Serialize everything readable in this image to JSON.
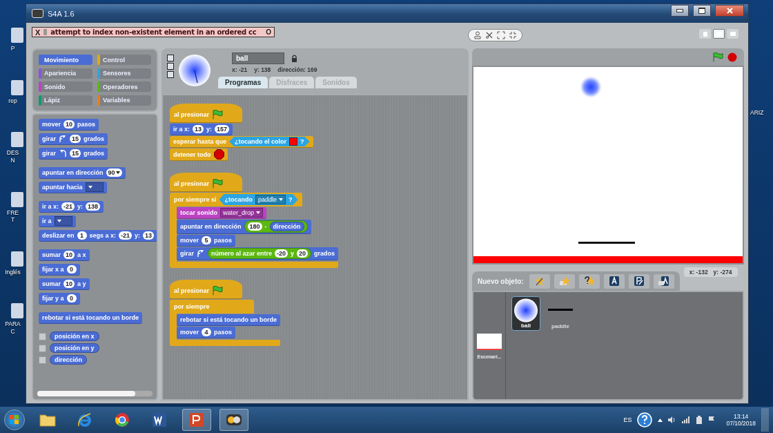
{
  "desktop": {
    "left_labels": [
      {
        "lines": [
          "P"
        ]
      },
      {
        "lines": [
          "rep"
        ]
      },
      {
        "lines": [
          "DES",
          "N"
        ]
      },
      {
        "lines": [
          "FRE",
          "T"
        ]
      },
      {
        "lines": [
          "Inglés"
        ]
      },
      {
        "lines": [
          "PARA",
          "C"
        ]
      }
    ],
    "right_labels": [
      "ARIZ"
    ]
  },
  "window": {
    "title": "S4A 1.6"
  },
  "error_bar": {
    "close": "X",
    "message": "attempt to index non-existent element in an ordered cc",
    "open": "O"
  },
  "view_modes": [
    {
      "selected": false
    },
    {
      "selected": true
    },
    {
      "selected": false
    }
  ],
  "categories": [
    {
      "label": "Movimiento",
      "color": "#4a6cd4",
      "selected": true
    },
    {
      "label": "Control",
      "color": "#e1a91a",
      "selected": false
    },
    {
      "label": "Apariencia",
      "color": "#8a55d7",
      "selected": false
    },
    {
      "label": "Sensores",
      "color": "#2ca5e2",
      "selected": false
    },
    {
      "label": "Sonido",
      "color": "#bb42c3",
      "selected": false
    },
    {
      "label": "Operadores",
      "color": "#5cb712",
      "selected": false
    },
    {
      "label": "Lápiz",
      "color": "#0e9a6c",
      "selected": false
    },
    {
      "label": "Variables",
      "color": "#ee7d16",
      "selected": false
    }
  ],
  "palette": {
    "groups": [
      [
        {
          "kind": "stack",
          "color": "#4a6cd4",
          "parts": [
            {
              "kind": "text",
              "text": "mover"
            },
            {
              "kind": "number",
              "text": "10"
            },
            {
              "kind": "text",
              "text": "pasos"
            }
          ]
        },
        {
          "kind": "stack",
          "color": "#4a6cd4",
          "parts": [
            {
              "kind": "text",
              "text": "girar"
            },
            {
              "kind": "turn_cw"
            },
            {
              "kind": "number",
              "text": "15"
            },
            {
              "kind": "text",
              "text": "grados"
            }
          ]
        },
        {
          "kind": "stack",
          "color": "#4a6cd4",
          "parts": [
            {
              "kind": "text",
              "text": "girar"
            },
            {
              "kind": "turn_ccw"
            },
            {
              "kind": "number",
              "text": "15"
            },
            {
              "kind": "text",
              "text": "grados"
            }
          ]
        }
      ],
      [
        {
          "kind": "stack",
          "color": "#4a6cd4",
          "parts": [
            {
              "kind": "text",
              "text": "apuntar en dirección"
            },
            {
              "kind": "number_dropdown",
              "text": "90"
            }
          ]
        },
        {
          "kind": "stack",
          "color": "#4a6cd4",
          "parts": [
            {
              "kind": "text",
              "text": "apuntar hacia"
            },
            {
              "kind": "dropdown"
            }
          ]
        }
      ],
      [
        {
          "kind": "stack",
          "color": "#4a6cd4",
          "parts": [
            {
              "kind": "text",
              "text": "ir a x:"
            },
            {
              "kind": "number",
              "text": "-21"
            },
            {
              "kind": "text",
              "text": "y:"
            },
            {
              "kind": "number",
              "text": "138"
            }
          ]
        },
        {
          "kind": "stack",
          "color": "#4a6cd4",
          "parts": [
            {
              "kind": "text",
              "text": "ir a"
            },
            {
              "kind": "dropdown"
            }
          ]
        },
        {
          "kind": "stack",
          "color": "#4a6cd4",
          "parts": [
            {
              "kind": "text",
              "text": "deslizar en"
            },
            {
              "kind": "number",
              "text": "1"
            },
            {
              "kind": "text",
              "text": "segs a x:"
            },
            {
              "kind": "number",
              "text": "-21"
            },
            {
              "kind": "text",
              "text": "y:"
            },
            {
              "kind": "number",
              "text": "13"
            }
          ]
        }
      ],
      [
        {
          "kind": "stack",
          "color": "#4a6cd4",
          "parts": [
            {
              "kind": "text",
              "text": "sumar"
            },
            {
              "kind": "number",
              "text": "10"
            },
            {
              "kind": "text",
              "text": "a x"
            }
          ]
        },
        {
          "kind": "stack",
          "color": "#4a6cd4",
          "parts": [
            {
              "kind": "text",
              "text": "fijar x a"
            },
            {
              "kind": "number",
              "text": "0"
            }
          ]
        },
        {
          "kind": "stack",
          "color": "#4a6cd4",
          "parts": [
            {
              "kind": "text",
              "text": "sumar"
            },
            {
              "kind": "number",
              "text": "10"
            },
            {
              "kind": "text",
              "text": "a y"
            }
          ]
        },
        {
          "kind": "stack",
          "color": "#4a6cd4",
          "parts": [
            {
              "kind": "text",
              "text": "fijar y a"
            },
            {
              "kind": "number",
              "text": "0"
            }
          ]
        }
      ],
      [
        {
          "kind": "stack",
          "color": "#4a6cd4",
          "parts": [
            {
              "kind": "text",
              "text": "rebotar si está tocando un borde"
            }
          ]
        }
      ],
      [
        {
          "kind": "checkbox_reporter",
          "color": "#4a6cd4",
          "checked": false,
          "parts": [
            {
              "kind": "text",
              "text": "posición en x"
            }
          ]
        },
        {
          "kind": "checkbox_reporter",
          "color": "#4a6cd4",
          "checked": false,
          "parts": [
            {
              "kind": "text",
              "text": "posición en y"
            }
          ]
        },
        {
          "kind": "checkbox_reporter",
          "color": "#4a6cd4",
          "checked": false,
          "parts": [
            {
              "kind": "text",
              "text": "dirección"
            }
          ]
        }
      ]
    ]
  },
  "sprite": {
    "name": "ball",
    "x": "x: -21",
    "y": "y: 138",
    "direction": "dirección: 169"
  },
  "tabs": [
    {
      "label": "Programas",
      "selected": true
    },
    {
      "label": "Disfraces",
      "selected": false
    },
    {
      "label": "Sonidos",
      "selected": false
    }
  ],
  "scripts": [
    [
      {
        "kind": "hat",
        "color": "#e1a91a",
        "parts": [
          {
            "kind": "text",
            "text": "al presionar"
          },
          {
            "kind": "flag"
          }
        ]
      },
      {
        "kind": "stack",
        "color": "#4a6cd4",
        "parts": [
          {
            "kind": "text",
            "text": "ir a x:"
          },
          {
            "kind": "number",
            "text": "13"
          },
          {
            "kind": "text",
            "text": "y:"
          },
          {
            "kind": "number",
            "text": "157"
          }
        ]
      },
      {
        "kind": "stack",
        "color": "#e1a91a",
        "parts": [
          {
            "kind": "text",
            "text": "esperar hasta que"
          },
          {
            "kind": "boolean",
            "color": "#2ca5e2",
            "parts": [
              {
                "kind": "text",
                "text": "¿tocando el color"
              },
              {
                "kind": "color",
                "color": "#ff0000"
              },
              {
                "kind": "text",
                "text": "?"
              }
            ]
          }
        ]
      },
      {
        "kind": "stack",
        "color": "#e1a91a",
        "parts": [
          {
            "kind": "text",
            "text": "detener todo"
          },
          {
            "kind": "stop"
          }
        ]
      }
    ],
    [
      {
        "kind": "hat",
        "color": "#e1a91a",
        "parts": [
          {
            "kind": "text",
            "text": "al presionar"
          },
          {
            "kind": "flag"
          }
        ]
      },
      {
        "kind": "c",
        "color": "#e1a91a",
        "parts": [
          {
            "kind": "text",
            "text": "por siempre si"
          },
          {
            "kind": "boolean",
            "color": "#2ca5e2",
            "parts": [
              {
                "kind": "text",
                "text": "¿tocando"
              },
              {
                "kind": "dropdown",
                "text": "paddle"
              },
              {
                "kind": "text",
                "text": "?"
              }
            ]
          }
        ],
        "children": [
          {
            "kind": "stack",
            "color": "#bb42c3",
            "parts": [
              {
                "kind": "text",
                "text": "tocar sonido"
              },
              {
                "kind": "dropdown",
                "text": "water_drop"
              }
            ]
          },
          {
            "kind": "stack",
            "color": "#4a6cd4",
            "parts": [
              {
                "kind": "text",
                "text": "apuntar en dirección"
              },
              {
                "kind": "reporter",
                "color": "#5cb712",
                "parts": [
                  {
                    "kind": "number",
                    "text": "180"
                  },
                  {
                    "kind": "text",
                    "text": "-"
                  },
                  {
                    "kind": "reporter",
                    "color": "#4a6cd4",
                    "parts": [
                      {
                        "kind": "text",
                        "text": "dirección"
                      }
                    ]
                  }
                ]
              }
            ]
          },
          {
            "kind": "stack",
            "color": "#4a6cd4",
            "parts": [
              {
                "kind": "text",
                "text": "mover"
              },
              {
                "kind": "number",
                "text": "5"
              },
              {
                "kind": "text",
                "text": "pasos"
              }
            ]
          },
          {
            "kind": "stack",
            "color": "#4a6cd4",
            "parts": [
              {
                "kind": "text",
                "text": "girar"
              },
              {
                "kind": "turn_cw"
              },
              {
                "kind": "reporter",
                "color": "#5cb712",
                "parts": [
                  {
                    "kind": "text",
                    "text": "número al azar entre"
                  },
                  {
                    "kind": "number",
                    "text": "-20"
                  },
                  {
                    "kind": "text",
                    "text": "y"
                  },
                  {
                    "kind": "number",
                    "text": "20"
                  }
                ]
              },
              {
                "kind": "text",
                "text": "grados"
              }
            ]
          }
        ]
      }
    ],
    [
      {
        "kind": "hat",
        "color": "#e1a91a",
        "parts": [
          {
            "kind": "text",
            "text": "al presionar"
          },
          {
            "kind": "flag"
          }
        ]
      },
      {
        "kind": "c",
        "color": "#e1a91a",
        "parts": [
          {
            "kind": "text",
            "text": "por siempre"
          }
        ],
        "children": [
          {
            "kind": "stack",
            "color": "#4a6cd4",
            "parts": [
              {
                "kind": "text",
                "text": "rebotar si está tocando un borde"
              }
            ]
          },
          {
            "kind": "stack",
            "color": "#4a6cd4",
            "parts": [
              {
                "kind": "text",
                "text": "mover"
              },
              {
                "kind": "number",
                "text": "4"
              },
              {
                "kind": "text",
                "text": "pasos"
              }
            ]
          }
        ]
      }
    ]
  ],
  "tray": {
    "label": "Nuevo objeto:",
    "mouse_x": "x: -132",
    "mouse_y": "y: -274",
    "sprites": [
      {
        "name": "ball",
        "kind": "ball",
        "selected": true
      },
      {
        "name": "paddle",
        "kind": "paddle",
        "selected": false
      }
    ],
    "stage_label": "Escenari..."
  },
  "taskbar": {
    "apps": [
      {
        "kind": "folder",
        "open": false
      },
      {
        "kind": "e",
        "open": false
      },
      {
        "kind": "chrome",
        "open": false
      },
      {
        "kind": "word",
        "open": false
      },
      {
        "kind": "powerpoint",
        "open": true
      },
      {
        "kind": "s4a",
        "open": true
      }
    ],
    "language": "ES",
    "time": "13:14",
    "date": "07/10/2018"
  }
}
